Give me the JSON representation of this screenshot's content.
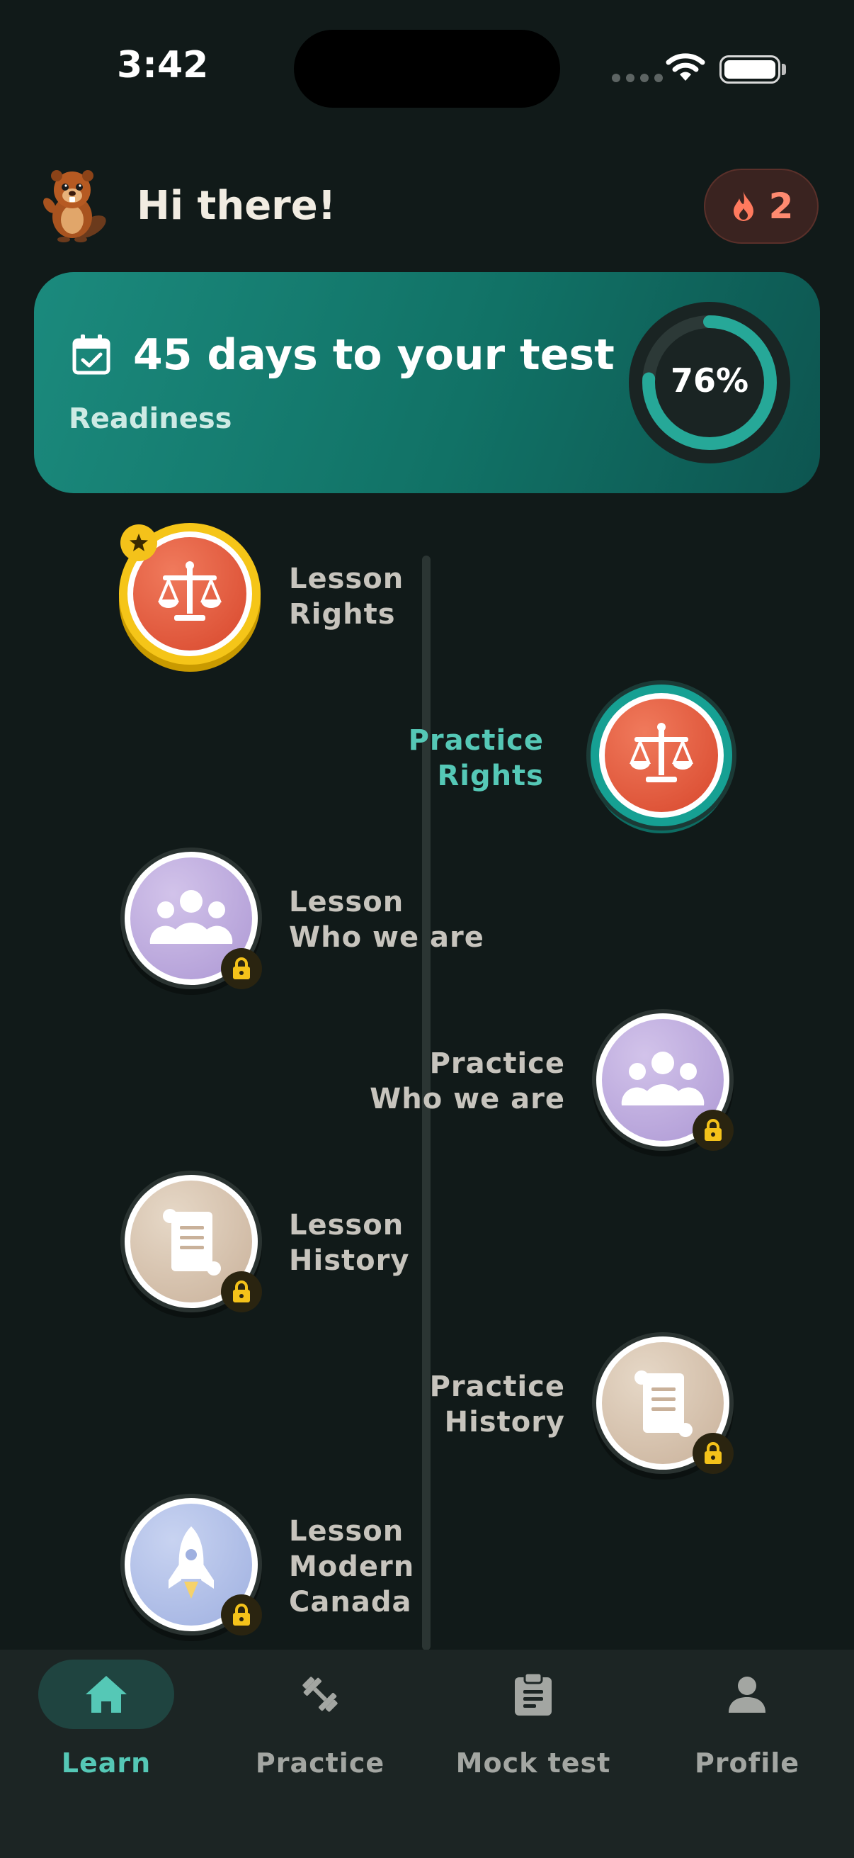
{
  "status_bar": {
    "time": "3:42"
  },
  "header": {
    "greeting": "Hi there!",
    "streak_count": "2"
  },
  "countdown": {
    "title": "45 days to your test",
    "subtitle": "Readiness",
    "readiness_percent": 76,
    "readiness_label": "76%"
  },
  "colors": {
    "accent": "#55c8b6",
    "card": "#137a6e",
    "lock_badge": "#f4c21a",
    "rights_node": "#e05a3d",
    "who_node": "#b9a6d8",
    "history_node": "#d9c6b2",
    "modern_node": "#aebde8"
  },
  "path": {
    "nodes": [
      {
        "kind": "Lesson",
        "topic": "Rights",
        "icon": "scales-icon",
        "status": "completed"
      },
      {
        "kind": "Practice",
        "topic": "Rights",
        "icon": "scales-icon",
        "status": "current"
      },
      {
        "kind": "Lesson",
        "topic": "Who we are",
        "icon": "people-icon",
        "status": "locked"
      },
      {
        "kind": "Practice",
        "topic": "Who we are",
        "icon": "people-icon",
        "status": "locked"
      },
      {
        "kind": "Lesson",
        "topic": "History",
        "icon": "scroll-icon",
        "status": "locked"
      },
      {
        "kind": "Practice",
        "topic": "History",
        "icon": "scroll-icon",
        "status": "locked"
      },
      {
        "kind": "Lesson",
        "topic": "Modern Canada",
        "topic_lines": [
          "Modern",
          "Canada"
        ],
        "icon": "rocket-icon",
        "status": "locked"
      }
    ]
  },
  "bottom_nav": {
    "items": [
      {
        "label": "Learn",
        "icon": "home-icon",
        "active": true
      },
      {
        "label": "Practice",
        "icon": "dumbbell-icon",
        "active": false
      },
      {
        "label": "Mock test",
        "icon": "clipboard-icon",
        "active": false
      },
      {
        "label": "Profile",
        "icon": "person-icon",
        "active": false
      }
    ]
  }
}
